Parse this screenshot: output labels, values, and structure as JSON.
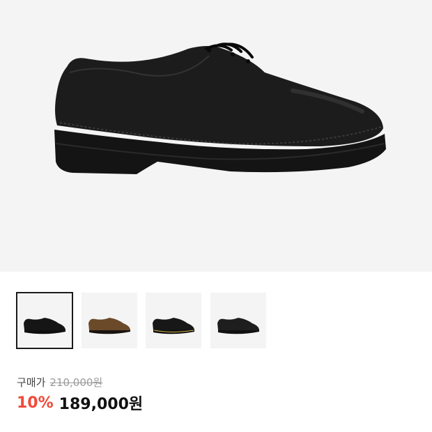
{
  "product": {
    "main_image": "black-derby-shoe",
    "thumbnails": [
      {
        "name": "black-smooth-shoe",
        "selected": true
      },
      {
        "name": "tan-brown-shoe",
        "selected": false
      },
      {
        "name": "black-yellow-stitch-shoe",
        "selected": false
      },
      {
        "name": "black-shoe-side",
        "selected": false
      }
    ]
  },
  "pricing": {
    "label": "구매가",
    "original_price": "210,000원",
    "discount": "10%",
    "sale_price": "189,000원"
  },
  "colors": {
    "discount": "#f04a3a",
    "hero_bg": "#f4f4f4",
    "selected_border": "#1b1b1b"
  }
}
